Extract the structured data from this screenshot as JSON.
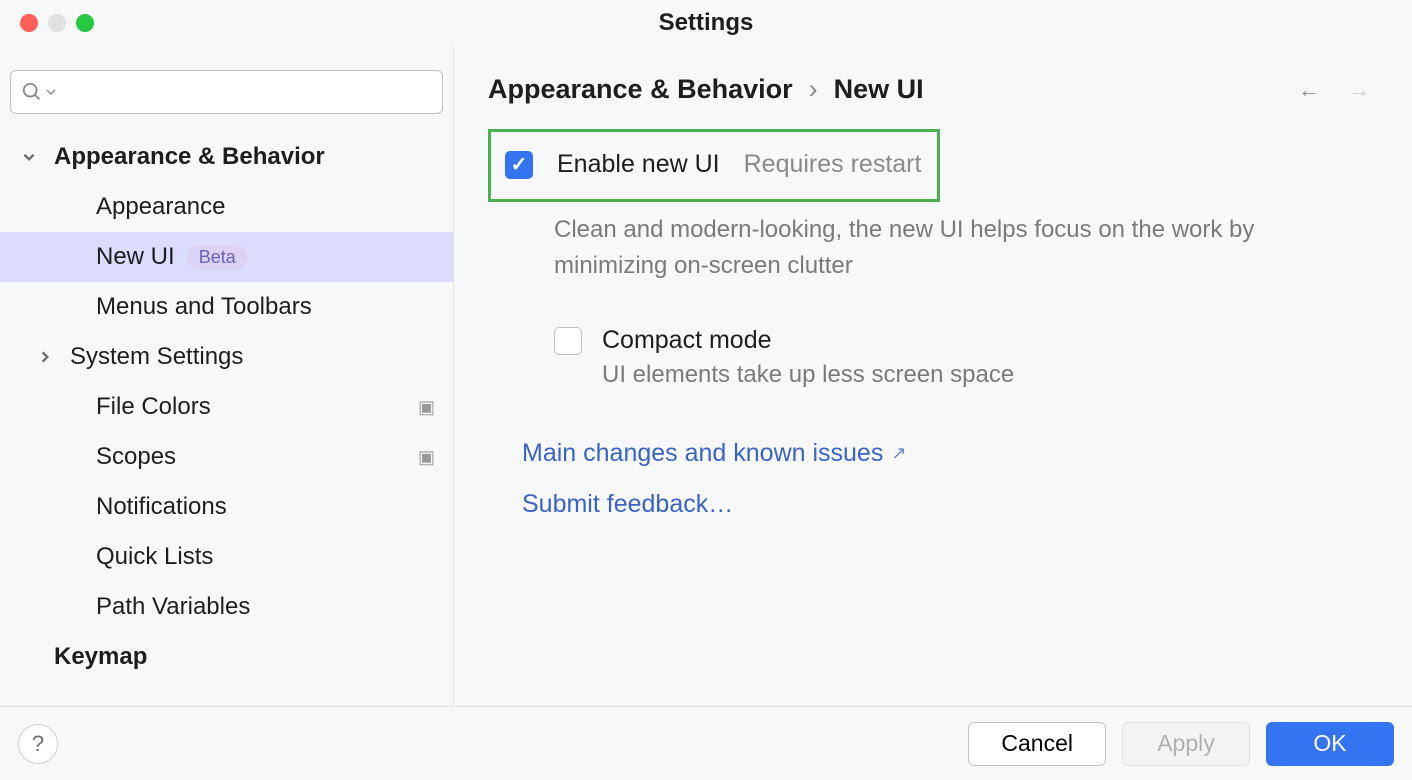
{
  "window": {
    "title": "Settings"
  },
  "search": {
    "placeholder": ""
  },
  "sidebar": {
    "section": "Appearance & Behavior",
    "items": [
      {
        "label": "Appearance"
      },
      {
        "label": "New UI",
        "badge": "Beta"
      },
      {
        "label": "Menus and Toolbars"
      },
      {
        "label": "System Settings"
      },
      {
        "label": "File Colors"
      },
      {
        "label": "Scopes"
      },
      {
        "label": "Notifications"
      },
      {
        "label": "Quick Lists"
      },
      {
        "label": "Path Variables"
      }
    ],
    "section2": "Keymap"
  },
  "breadcrumb": {
    "parent": "Appearance & Behavior",
    "current": "New UI"
  },
  "options": {
    "enable": {
      "label": "Enable new UI",
      "hint": "Requires restart",
      "desc": "Clean and modern-looking, the new UI helps focus on the work by minimizing on-screen clutter"
    },
    "compact": {
      "label": "Compact mode",
      "desc": "UI elements take up less screen space"
    }
  },
  "links": {
    "changes": "Main changes and known issues",
    "feedback": "Submit feedback…"
  },
  "footer": {
    "cancel": "Cancel",
    "apply": "Apply",
    "ok": "OK"
  }
}
